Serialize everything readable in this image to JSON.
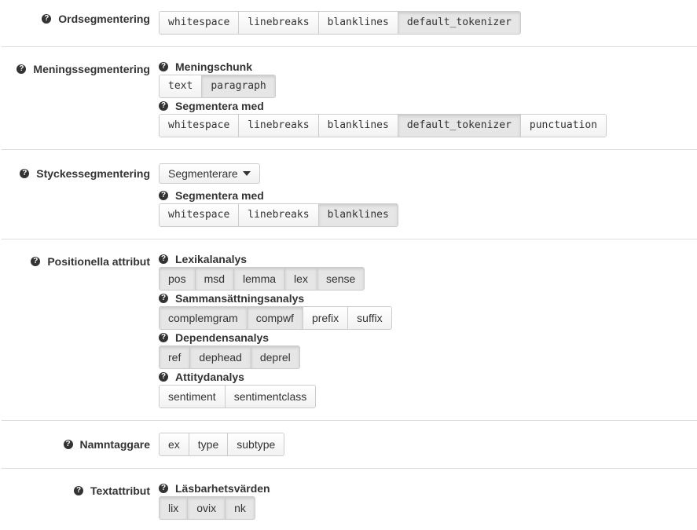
{
  "ordseg": {
    "label": "Ordsegmentering",
    "options": [
      {
        "label": "whitespace",
        "on": false
      },
      {
        "label": "linebreaks",
        "on": false
      },
      {
        "label": "blanklines",
        "on": false
      },
      {
        "label": "default_tokenizer",
        "on": true
      }
    ]
  },
  "meningsseg": {
    "label": "Meningssegmentering",
    "chunk_label": "Meningschunk",
    "chunk_options": [
      {
        "label": "text",
        "on": false
      },
      {
        "label": "paragraph",
        "on": true
      }
    ],
    "segment_label": "Segmentera med",
    "segment_options": [
      {
        "label": "whitespace",
        "on": false
      },
      {
        "label": "linebreaks",
        "on": false
      },
      {
        "label": "blanklines",
        "on": false
      },
      {
        "label": "default_tokenizer",
        "on": true
      },
      {
        "label": "punctuation",
        "on": false
      }
    ]
  },
  "styckesseg": {
    "label": "Styckessegmentering",
    "dropdown_label": "Segmenterare",
    "segment_label": "Segmentera med",
    "segment_options": [
      {
        "label": "whitespace",
        "on": false
      },
      {
        "label": "linebreaks",
        "on": false
      },
      {
        "label": "blanklines",
        "on": true
      }
    ]
  },
  "positionella": {
    "label": "Positionella attribut",
    "lexikal_label": "Lexikalanalys",
    "lexikal_options": [
      {
        "label": "pos",
        "on": true
      },
      {
        "label": "msd",
        "on": true
      },
      {
        "label": "lemma",
        "on": true
      },
      {
        "label": "lex",
        "on": true
      },
      {
        "label": "sense",
        "on": true
      }
    ],
    "samman_label": "Sammansättningsanalys",
    "samman_options": [
      {
        "label": "complemgram",
        "on": true
      },
      {
        "label": "compwf",
        "on": true
      },
      {
        "label": "prefix",
        "on": false
      },
      {
        "label": "suffix",
        "on": false
      }
    ],
    "dependens_label": "Dependensanalys",
    "dependens_options": [
      {
        "label": "ref",
        "on": true
      },
      {
        "label": "dephead",
        "on": true
      },
      {
        "label": "deprel",
        "on": true
      }
    ],
    "attityd_label": "Attitydanalys",
    "attityd_options": [
      {
        "label": "sentiment",
        "on": false
      },
      {
        "label": "sentimentclass",
        "on": false
      }
    ]
  },
  "namntaggare": {
    "label": "Namntaggare",
    "options": [
      {
        "label": "ex",
        "on": false
      },
      {
        "label": "type",
        "on": false
      },
      {
        "label": "subtype",
        "on": false
      }
    ]
  },
  "textattribut": {
    "label": "Textattribut",
    "lasbarhet_label": "Läsbarhetsvärden",
    "lasbarhet_options": [
      {
        "label": "lix",
        "on": true
      },
      {
        "label": "ovix",
        "on": true
      },
      {
        "label": "nk",
        "on": true
      }
    ]
  },
  "help_icon_glyph": "?"
}
